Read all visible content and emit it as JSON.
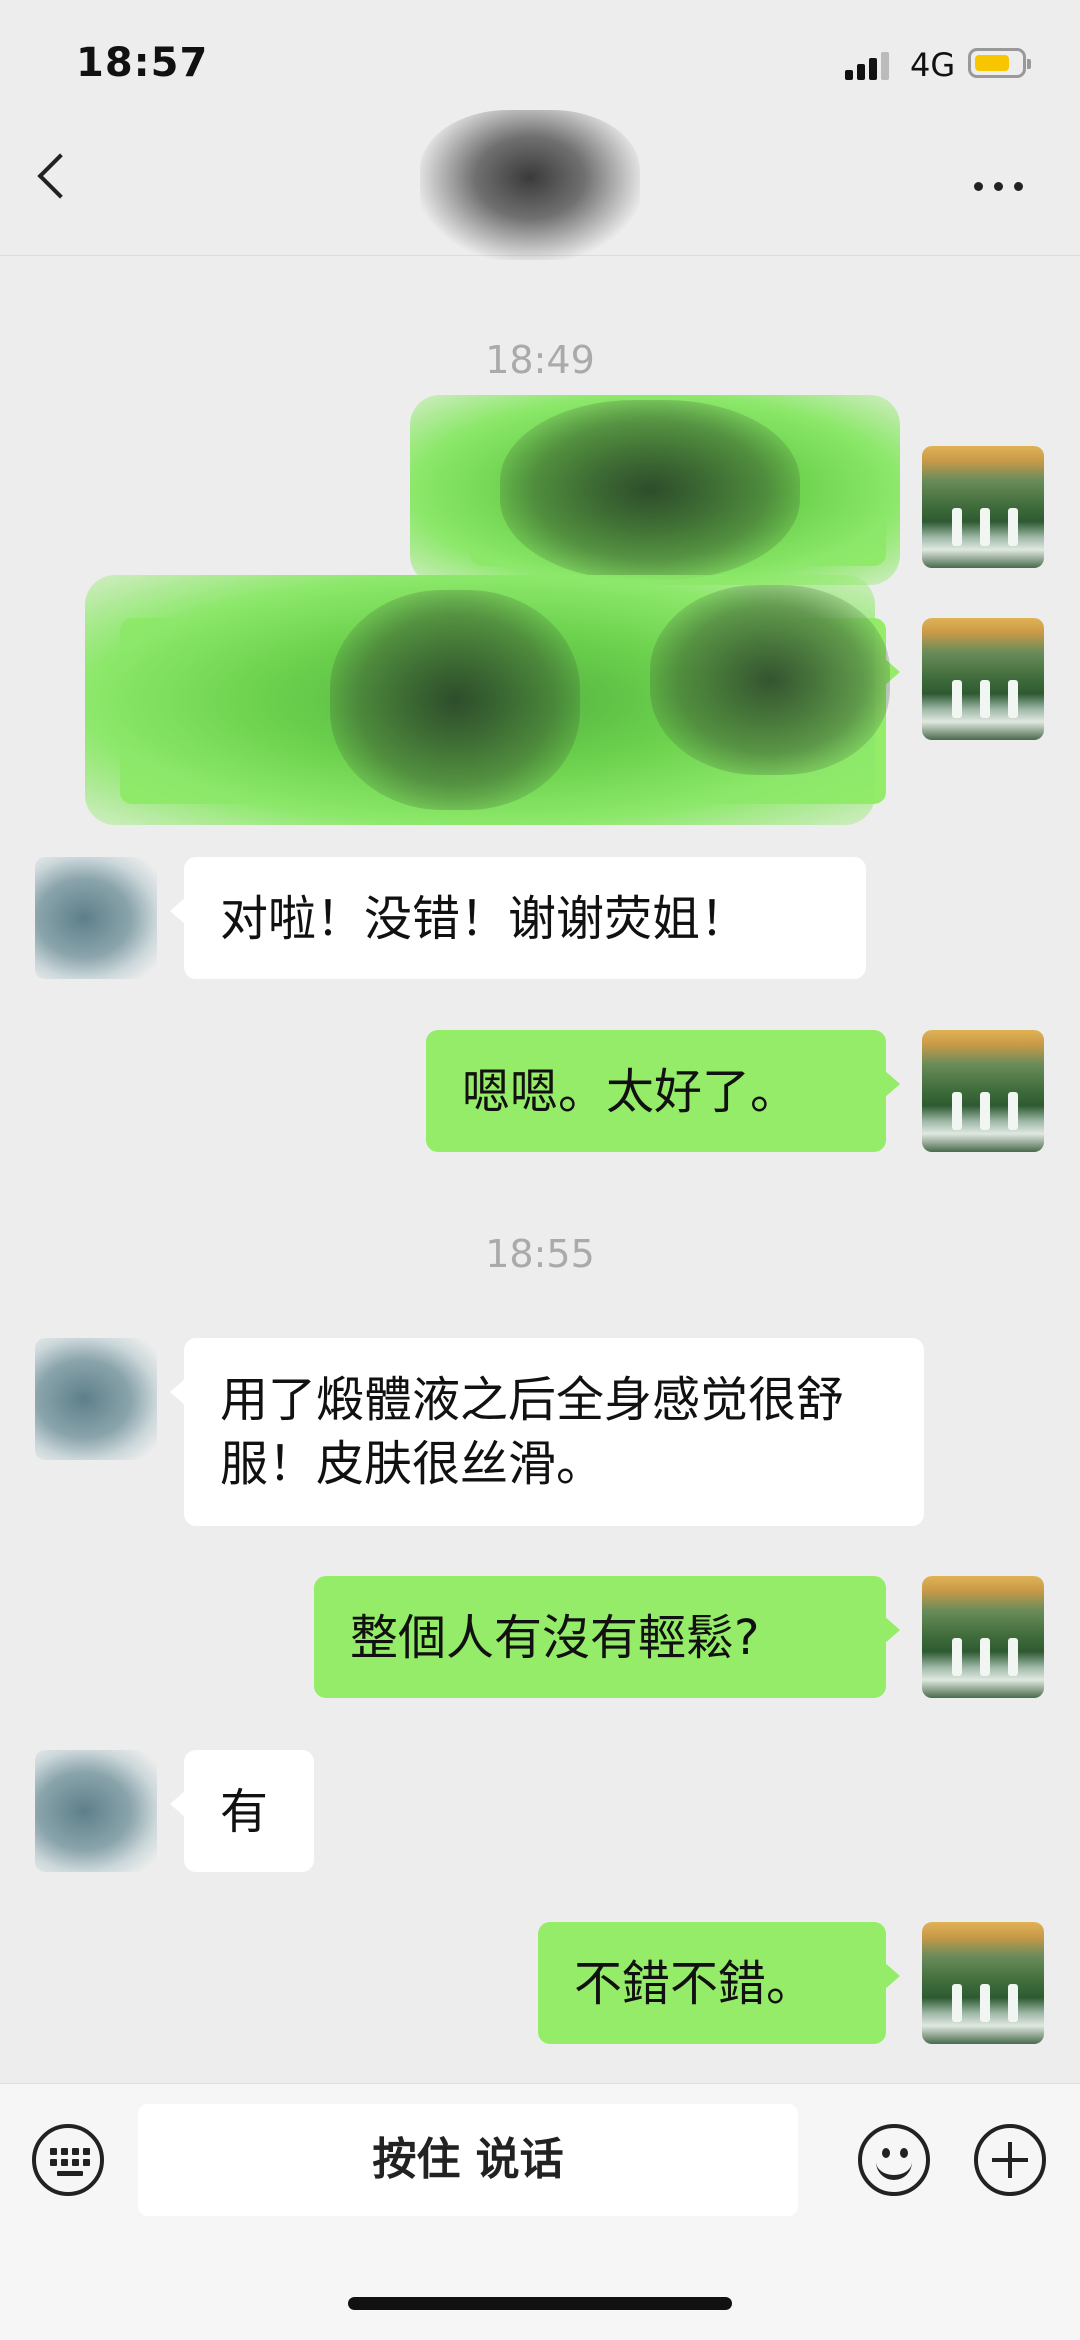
{
  "status_bar": {
    "time": "18:57",
    "network": "4G"
  },
  "nav": {
    "title": ""
  },
  "timestamps": [
    "18:49",
    "18:55"
  ],
  "messages": [
    {
      "from": "me",
      "text": ""
    },
    {
      "from": "me",
      "text": "。"
    },
    {
      "from": "them",
      "text": "对啦！没错！谢谢荧姐！"
    },
    {
      "from": "me",
      "text": "嗯嗯。太好了。"
    },
    {
      "from": "them",
      "text": "用了煅體液之后全身感觉很舒服！皮肤很丝滑。"
    },
    {
      "from": "me",
      "text": "整個人有沒有輕鬆?"
    },
    {
      "from": "them",
      "text": "有"
    },
    {
      "from": "me",
      "text": "不錯不錯。"
    }
  ],
  "input_bar": {
    "hold_to_talk": "按住 说话"
  },
  "icons": [
    "back-arrow-icon",
    "more-icon",
    "keyboard-icon",
    "emoji-icon",
    "plus-icon"
  ],
  "colors": {
    "my_bubble": "#95ec69",
    "their_bubble": "#ffffff",
    "background": "#ededed"
  }
}
